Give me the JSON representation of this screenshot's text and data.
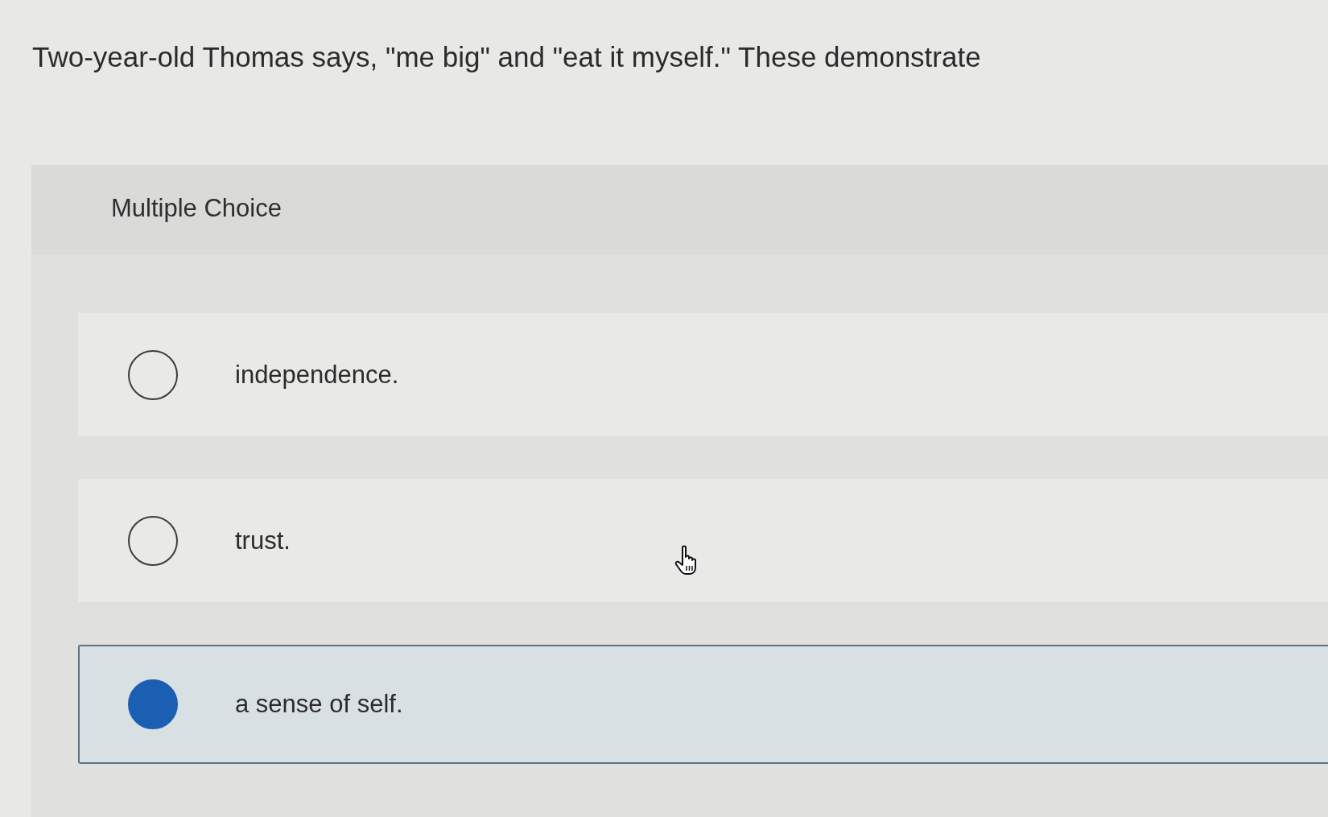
{
  "question": "Two-year-old Thomas says, \"me big\" and \"eat it myself.\" These demonstrate",
  "panel": {
    "heading": "Multiple Choice"
  },
  "options": [
    {
      "text": "independence.",
      "selected": false
    },
    {
      "text": "trust.",
      "selected": false
    },
    {
      "text": "a sense of self.",
      "selected": true
    }
  ]
}
